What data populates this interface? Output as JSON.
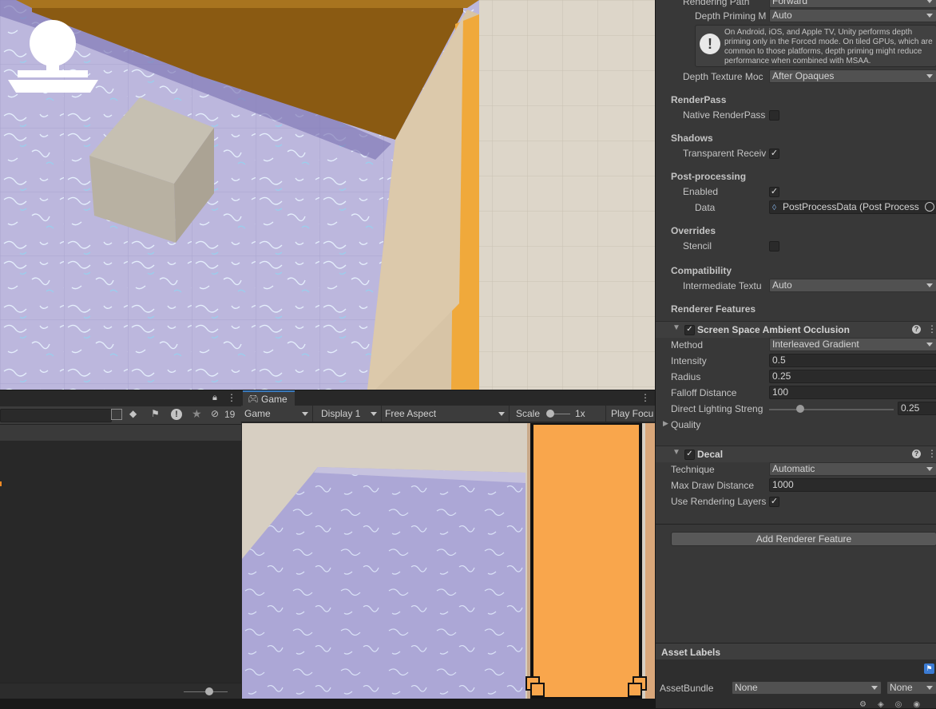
{
  "inspector": {
    "rendering_path_label": "Rendering Path",
    "rendering_path_value": "Forward",
    "depth_priming_label": "Depth Priming M",
    "depth_priming_value": "Auto",
    "help_text": "On Android, iOS, and Apple TV, Unity performs depth priming only in the Forced mode. On tiled GPUs, which are common to those platforms, depth priming might reduce performance when combined with MSAA.",
    "depth_texture_label": "Depth Texture Moc",
    "depth_texture_value": "After Opaques",
    "renderpass_header": "RenderPass",
    "native_renderpass_label": "Native RenderPass",
    "shadows_header": "Shadows",
    "transparent_receive_label": "Transparent Receiv",
    "postprocessing_header": "Post-processing",
    "enabled_label": "Enabled",
    "data_label": "Data",
    "data_value": "PostProcessData (Post Process",
    "overrides_header": "Overrides",
    "stencil_label": "Stencil",
    "compatibility_header": "Compatibility",
    "intermediate_label": "Intermediate Textu",
    "intermediate_value": "Auto",
    "renderer_features_header": "Renderer Features",
    "ssao": {
      "title": "Screen Space Ambient Occlusion",
      "method_label": "Method",
      "method_value": "Interleaved Gradient",
      "intensity_label": "Intensity",
      "intensity_value": "0.5",
      "radius_label": "Radius",
      "radius_value": "0.25",
      "falloff_label": "Falloff Distance",
      "falloff_value": "100",
      "direct_label": "Direct Lighting Streng",
      "direct_value": "0.25",
      "direct_fraction": 0.25,
      "quality_label": "Quality"
    },
    "decal": {
      "title": "Decal",
      "technique_label": "Technique",
      "technique_value": "Automatic",
      "maxdraw_label": "Max Draw Distance",
      "maxdraw_value": "1000",
      "use_layers_label": "Use Rendering Layers"
    },
    "add_feature_label": "Add Renderer Feature",
    "asset_labels_title": "Asset Labels",
    "assetbundle_label": "AssetBundle",
    "assetbundle_value": "None",
    "assetbundle_variant": "None"
  },
  "console": {
    "count_badge": "19"
  },
  "game": {
    "tab_label": "Game",
    "mode_value": "Game",
    "display_value": "Display 1",
    "aspect_value": "Free Aspect",
    "scale_label": "Scale",
    "scale_value": "1x",
    "play_focus_label": "Play Focu"
  },
  "colors": {
    "inspector_bg": "#383838",
    "accent_orange": "#f9a64c",
    "floor_lilac": "#a9a4d3",
    "wall_brown": "#8a5a12"
  }
}
